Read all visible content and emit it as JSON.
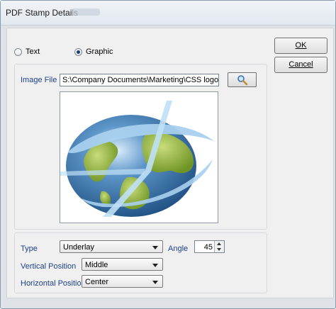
{
  "window": {
    "title": "PDF Stamp Details"
  },
  "stamp_type": {
    "options": [
      {
        "label": "Text",
        "checked": false
      },
      {
        "label": "Graphic",
        "checked": true
      }
    ]
  },
  "image_file": {
    "label": "Image File",
    "value": "S:\\Company Documents\\Marketing\\CSS logos RGB\\g",
    "browse_icon": "magnifier-icon"
  },
  "preview": {
    "description_icon": "globe-image"
  },
  "settings": {
    "type_label": "Type",
    "type_value": "Underlay",
    "angle_label": "Angle",
    "angle_value": "45",
    "vertical_label": "Vertical Position",
    "vertical_value": "Middle",
    "horizontal_label": "Horizontal Position",
    "horizontal_value": "Center"
  },
  "buttons": {
    "ok_label": "OK",
    "cancel_label": "Cancel"
  },
  "colors": {
    "label_blue": "#1e3f8a",
    "globe_ocean": "#2f6aa3",
    "globe_land": "#8fb13a"
  }
}
